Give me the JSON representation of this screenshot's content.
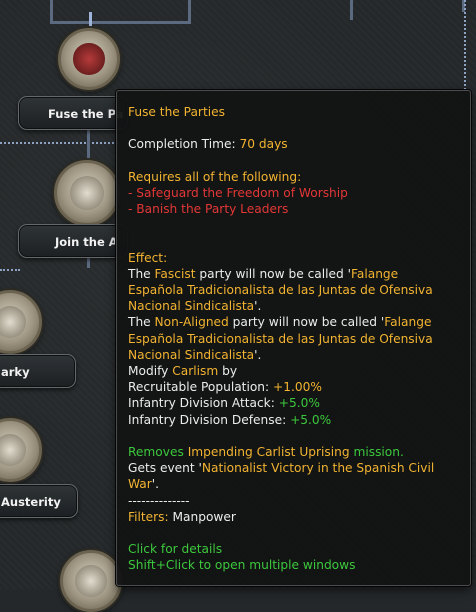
{
  "focus_tree": {
    "nodes": [
      {
        "label": "Fuse the Parties",
        "visible_label": "Fuse the Pa"
      },
      {
        "label": "Join the A",
        "visible_label": "Join the A"
      },
      {
        "label": "arky",
        "visible_label": "arky"
      },
      {
        "label": "Austerity",
        "visible_label": "Austerity"
      }
    ]
  },
  "tooltip": {
    "title": "Fuse the Parties",
    "completion_label": "Completion Time: ",
    "completion_value": "70 days",
    "requires_header": "Requires all of the following:",
    "requirements": [
      "- Safeguard the Freedom of Worship",
      "- Banish the Party Leaders"
    ],
    "effect_header": "Effect:",
    "fascist": {
      "l1_a": "The ",
      "party": "Fascist",
      "l1_b": " party will now be called '",
      "l1_c": "Falange",
      "l2": "Española Tradicionalista de las Juntas de Ofensiva",
      "l3": "Nacional Sindicalista",
      "l3_end": "'."
    },
    "nonaligned": {
      "l1_a": "The ",
      "party": "Non-Aligned",
      "l1_b": " party will now be called '",
      "l1_c": "Falange",
      "l2": "Española Tradicionalista de las Juntas de Ofensiva",
      "l3": "Nacional Sindicalista",
      "l3_end": "'."
    },
    "modify": {
      "prefix": "Modify ",
      "idea": "Carlism",
      "suffix": " by"
    },
    "modifiers": [
      {
        "label": "Recruitable Population: ",
        "value": "+1.00%"
      },
      {
        "label": "Infantry Division Attack: ",
        "value": "+5.0%"
      },
      {
        "label": "Infantry Division Defense: ",
        "value": "+5.0%"
      }
    ],
    "removes": {
      "a": "Removes ",
      "mission": "Impending Carlist Uprising",
      "b": " mission."
    },
    "event": {
      "a": "Gets event '",
      "name_l1": "Nationalist Victory in the Spanish Civil",
      "name_l2": "War",
      "b": "'."
    },
    "separator": "--------------",
    "filters_label": "Filters: ",
    "filters_value": "Manpower",
    "hints": [
      "Click for details",
      "Shift+Click to open multiple windows"
    ]
  },
  "colors": {
    "highlight": "#f2b431",
    "negative": "#e43737",
    "positive": "#3cc83c",
    "text": "#ececec",
    "tooltip_bg": "#121313"
  }
}
